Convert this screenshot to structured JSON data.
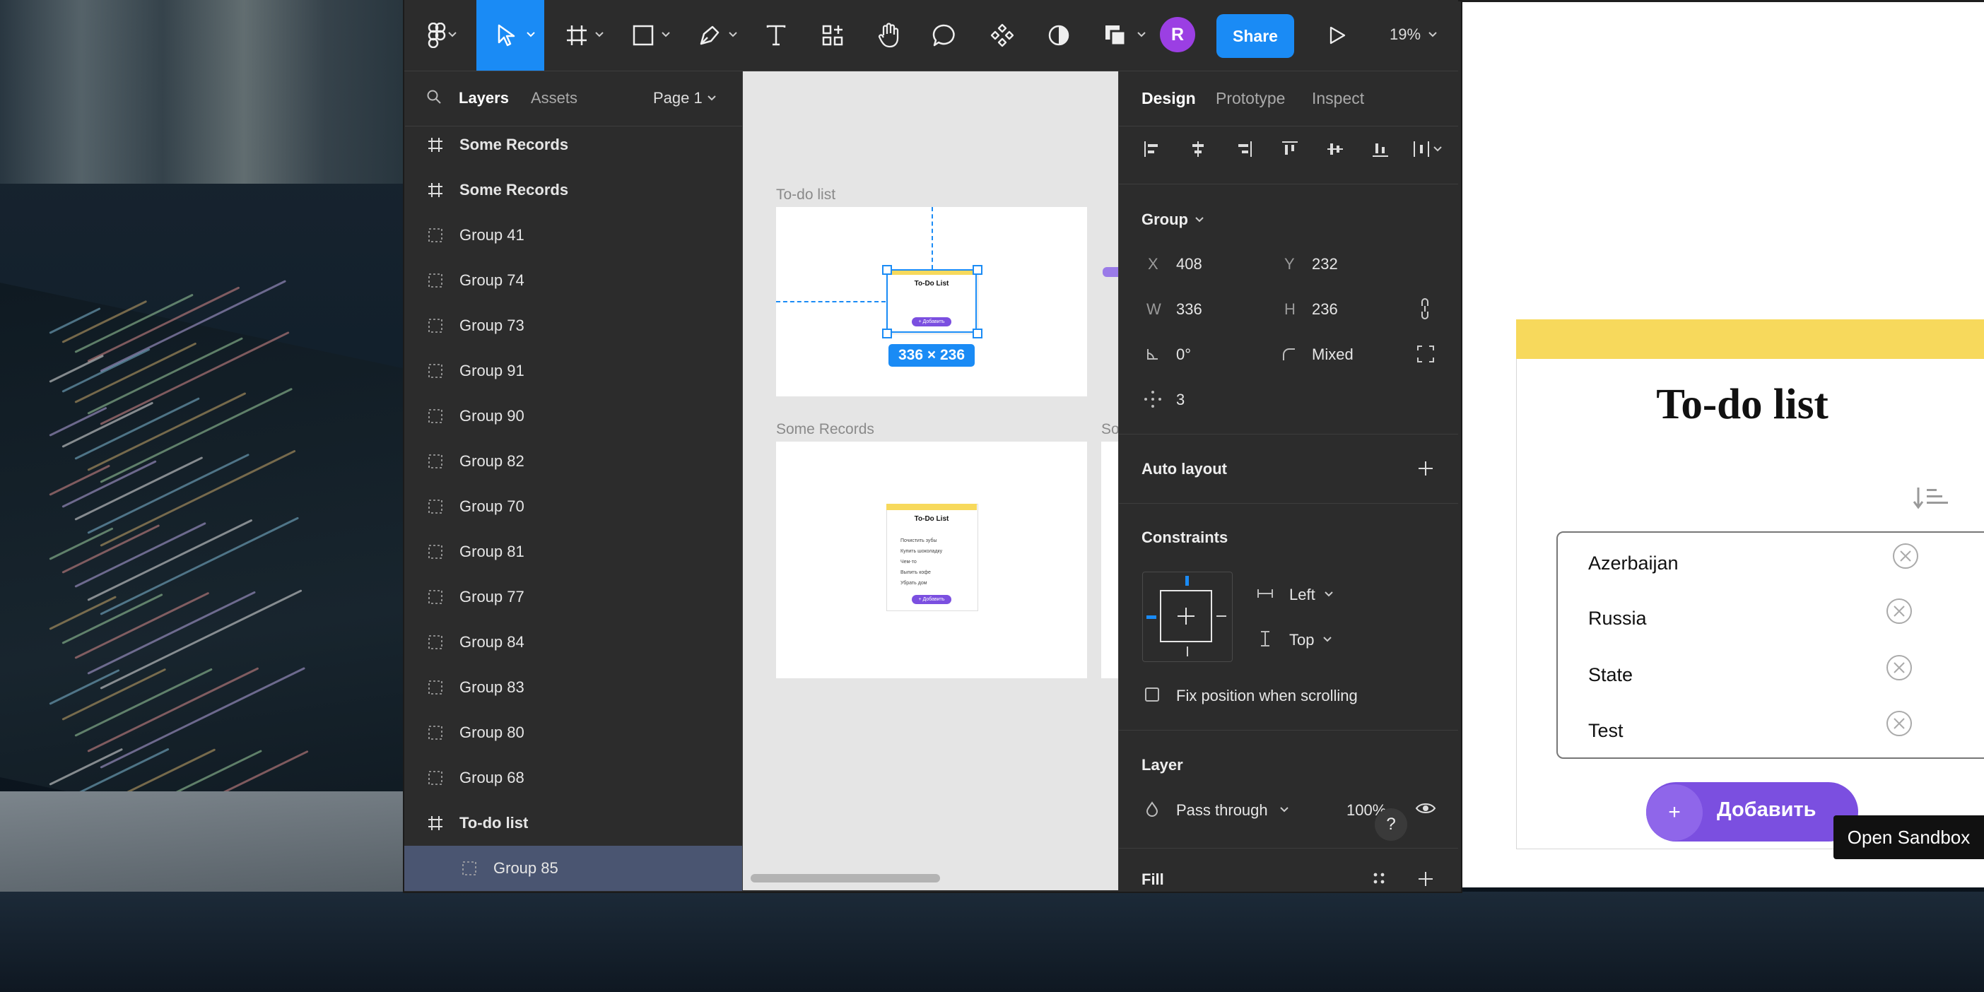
{
  "toolbar": {
    "share_label": "Share",
    "avatar_initial": "R",
    "zoom": "19%"
  },
  "layers_panel": {
    "tab_layers": "Layers",
    "tab_assets": "Assets",
    "page": "Page 1",
    "layers": [
      {
        "label": "Some Records",
        "type": "frame"
      },
      {
        "label": "Some Records",
        "type": "frame"
      },
      {
        "label": "Group 41",
        "type": "group"
      },
      {
        "label": "Group 74",
        "type": "group"
      },
      {
        "label": "Group 73",
        "type": "group"
      },
      {
        "label": "Group 91",
        "type": "group"
      },
      {
        "label": "Group 90",
        "type": "group"
      },
      {
        "label": "Group 82",
        "type": "group"
      },
      {
        "label": "Group 70",
        "type": "group"
      },
      {
        "label": "Group 81",
        "type": "group"
      },
      {
        "label": "Group 77",
        "type": "group"
      },
      {
        "label": "Group 84",
        "type": "group"
      },
      {
        "label": "Group 83",
        "type": "group"
      },
      {
        "label": "Group 80",
        "type": "group"
      },
      {
        "label": "Group 68",
        "type": "group"
      },
      {
        "label": "To-do list",
        "type": "frame"
      },
      {
        "label": "Group 85",
        "type": "group",
        "selected": true
      }
    ]
  },
  "canvas": {
    "frame1_label": "To-do list",
    "frame2_label": "Some Records",
    "frame3_label": "So",
    "mini_title": "To-Do List",
    "mini_button": "+ Добавить",
    "mini2_title": "To-Do List",
    "mini2_items": [
      "Почистить зубы",
      "Купить шоколадку",
      "Чем-то",
      "Выпить кофе",
      "Убрать дом"
    ],
    "size_badge": "336 × 236"
  },
  "design_panel": {
    "tabs": [
      "Design",
      "Prototype",
      "Inspect"
    ],
    "group_label": "Group",
    "x_label": "X",
    "x": "408",
    "y_label": "Y",
    "y": "232",
    "w_label": "W",
    "w": "336",
    "h_label": "H",
    "h": "236",
    "rotation": "0°",
    "radius": "Mixed",
    "count": "3",
    "auto_layout": "Auto layout",
    "constraints": "Constraints",
    "constraint_h": "Left",
    "constraint_v": "Top",
    "fix_position": "Fix position when scrolling",
    "layer": "Layer",
    "blend": "Pass through",
    "opacity": "100%",
    "fill": "Fill",
    "help": "?"
  },
  "preview": {
    "title": "To-do list",
    "items": [
      "Azerbaijan",
      "Russia",
      "State",
      "Test"
    ],
    "add_plus": "+",
    "add_label": "Добавить",
    "open_sandbox": "Open Sandbox"
  },
  "colors": {
    "figma_panel": "#2c2c2c",
    "accent_blue": "#1a8bf5",
    "todo_yellow": "#f7d95c",
    "todo_purple": "#7b4fe0",
    "avatar_purple": "#9b3fe3"
  }
}
